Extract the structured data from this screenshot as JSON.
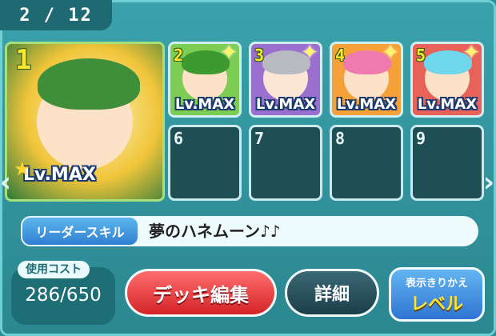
{
  "page_indicator": "2 / 12",
  "leader": {
    "number": "1",
    "level": "Lv.MAX",
    "hair_color": "#3f8f3a",
    "frame_color": "#f0c53a"
  },
  "members": [
    {
      "number": "2",
      "level": "Lv.MAX",
      "hair_color": "#3c9a30",
      "bg_color": "#7dcc54"
    },
    {
      "number": "3",
      "level": "Lv.MAX",
      "hair_color": "#b9b9c2",
      "bg_color": "#9b6fd0"
    },
    {
      "number": "4",
      "level": "Lv.MAX",
      "hair_color": "#ef7ab0",
      "bg_color": "#f5a13a"
    },
    {
      "number": "5",
      "level": "Lv.MAX",
      "hair_color": "#6fd7ec",
      "bg_color": "#e8625a"
    }
  ],
  "empty_slots": [
    {
      "number": "6"
    },
    {
      "number": "7"
    },
    {
      "number": "8"
    },
    {
      "number": "9"
    }
  ],
  "leader_skill": {
    "label": "リーダースキル",
    "name": "夢のハネムーン♪♪"
  },
  "cost": {
    "label": "使用コスト",
    "value": "286/650"
  },
  "buttons": {
    "deck_edit": "デッキ編集",
    "details": "詳細",
    "toggle_line1": "表示きりかえ",
    "toggle_line2": "レベル"
  },
  "nav": {
    "prev_icon": "chevron-left-icon",
    "next_icon": "chevron-right-icon"
  }
}
